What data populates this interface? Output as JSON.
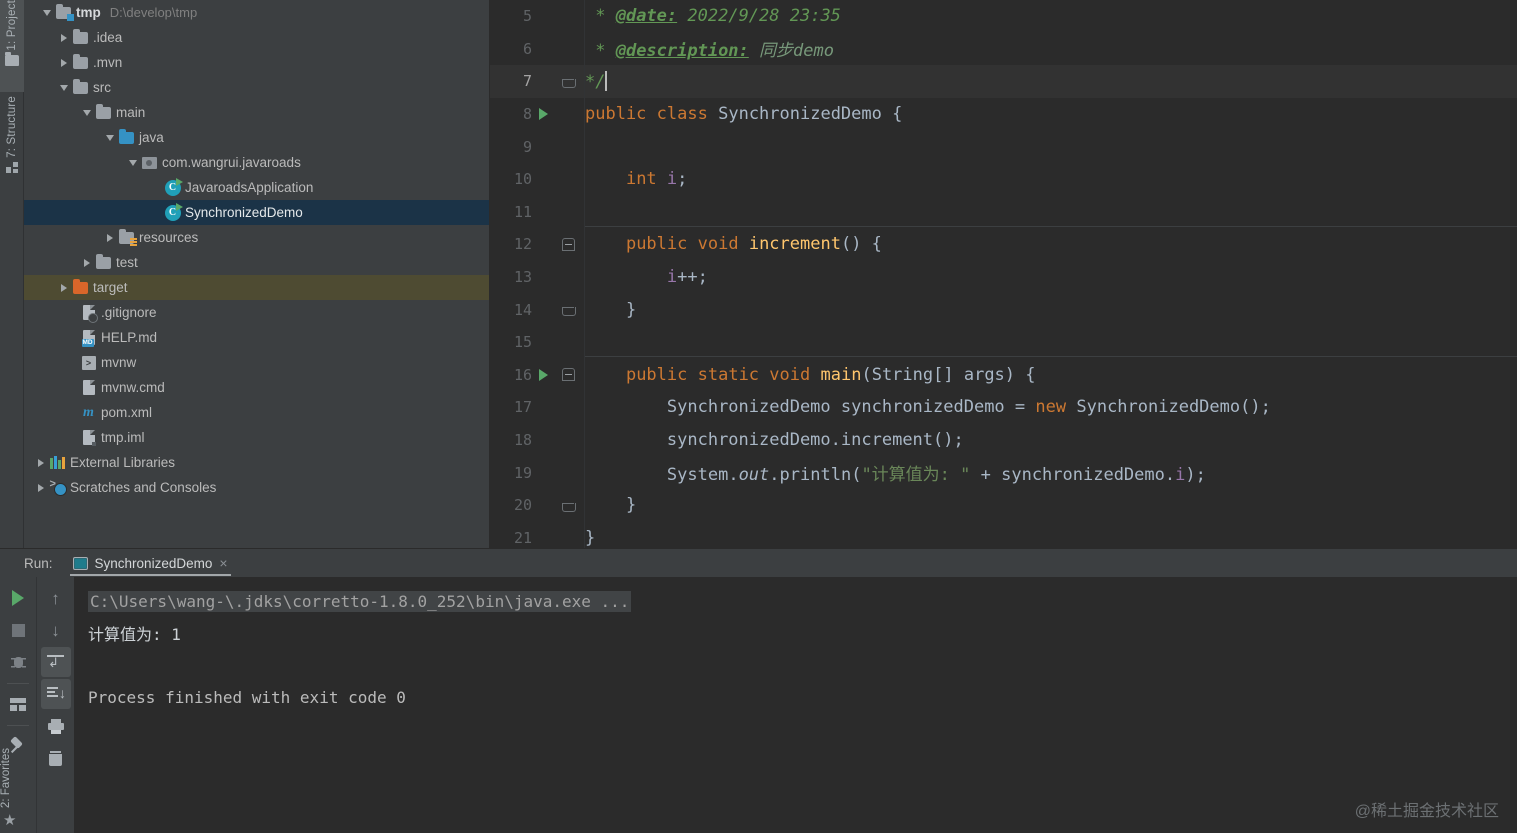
{
  "tool_windows": {
    "project": "1: Project",
    "structure": "7: Structure",
    "favorites": "2: Favorites"
  },
  "project_tree": {
    "root": {
      "name": "tmp",
      "path": "D:\\develop\\tmp"
    },
    "items": [
      {
        "label": ".idea",
        "indent": 1,
        "state": "collapsed",
        "icon": "folder-icon"
      },
      {
        "label": ".mvn",
        "indent": 1,
        "state": "collapsed",
        "icon": "folder-icon"
      },
      {
        "label": "src",
        "indent": 1,
        "state": "expanded",
        "icon": "folder-icon"
      },
      {
        "label": "main",
        "indent": 2,
        "state": "expanded",
        "icon": "folder-icon"
      },
      {
        "label": "java",
        "indent": 3,
        "state": "expanded",
        "icon": "source-folder-icon"
      },
      {
        "label": "com.wangrui.javaroads",
        "indent": 4,
        "state": "expanded",
        "icon": "package-icon"
      },
      {
        "label": "JavaroadsApplication",
        "indent": 5,
        "state": "leaf",
        "icon": "java-class-icon"
      },
      {
        "label": "SynchronizedDemo",
        "indent": 5,
        "state": "leaf",
        "icon": "java-class-icon",
        "selected": true
      },
      {
        "label": "resources",
        "indent": 3,
        "state": "collapsed",
        "icon": "resources-folder-icon"
      },
      {
        "label": "test",
        "indent": 2,
        "state": "collapsed",
        "icon": "folder-icon"
      },
      {
        "label": "target",
        "indent": 1,
        "state": "collapsed",
        "icon": "excluded-folder-icon",
        "highlighted": true
      },
      {
        "label": ".gitignore",
        "indent": 2,
        "state": "leaf",
        "icon": "gitignore-file-icon"
      },
      {
        "label": "HELP.md",
        "indent": 2,
        "state": "leaf",
        "icon": "markdown-file-icon",
        "badge": "MD"
      },
      {
        "label": "mvnw",
        "indent": 2,
        "state": "leaf",
        "icon": "shell-script-icon"
      },
      {
        "label": "mvnw.cmd",
        "indent": 2,
        "state": "leaf",
        "icon": "cmd-file-icon"
      },
      {
        "label": "pom.xml",
        "indent": 2,
        "state": "leaf",
        "icon": "maven-file-icon"
      },
      {
        "label": "tmp.iml",
        "indent": 2,
        "state": "leaf",
        "icon": "module-file-icon"
      },
      {
        "label": "External Libraries",
        "indent": 0,
        "state": "collapsed",
        "icon": "libraries-icon"
      },
      {
        "label": "Scratches and Consoles",
        "indent": 0,
        "state": "collapsed",
        "icon": "scratches-icon"
      }
    ]
  },
  "editor": {
    "first_visible_line": 5,
    "current_line": 7,
    "lines": [
      {
        "n": 5,
        "text": " * @date: 2022/9/28 23:35"
      },
      {
        "n": 6,
        "text": " * @description: 同步demo"
      },
      {
        "n": 7,
        "text": " */"
      },
      {
        "n": 8,
        "text": "public class SynchronizedDemo {"
      },
      {
        "n": 9,
        "text": ""
      },
      {
        "n": 10,
        "text": "    int i;"
      },
      {
        "n": 11,
        "text": ""
      },
      {
        "n": 12,
        "text": "    public void increment() {"
      },
      {
        "n": 13,
        "text": "        i++;"
      },
      {
        "n": 14,
        "text": "    }"
      },
      {
        "n": 15,
        "text": ""
      },
      {
        "n": 16,
        "text": "    public static void main(String[] args) {"
      },
      {
        "n": 17,
        "text": "        SynchronizedDemo synchronizedDemo = new SynchronizedDemo();"
      },
      {
        "n": 18,
        "text": "        synchronizedDemo.increment();"
      },
      {
        "n": 19,
        "text": "        System.out.println(\"计算值为: \" + synchronizedDemo.i);"
      },
      {
        "n": 20,
        "text": "    }"
      },
      {
        "n": 21,
        "text": "}"
      }
    ],
    "tokens": {
      "doc_date_tag": "@date:",
      "doc_date_value": "2022/9/28 23:35",
      "doc_desc_tag": "@description:",
      "doc_desc_value": "同步demo",
      "doc_close": "*/",
      "kw_public": "public",
      "kw_class": "class",
      "kw_void": "void",
      "kw_static": "static",
      "kw_int": "int",
      "kw_new": "new",
      "class_name": "SynchronizedDemo",
      "field_i": "i",
      "method_increment": "increment",
      "method_main": "main",
      "method_println": "println",
      "type_string_array": "String[]",
      "param_args": "args",
      "var_name": "synchronizedDemo",
      "system": "System",
      "out": "out",
      "string_literal": "\"计算值为: \""
    }
  },
  "run_panel": {
    "label": "Run:",
    "tab_name": "SynchronizedDemo",
    "close_label": "×",
    "toolbar_left": [
      {
        "name": "rerun-button",
        "icon": "play-icon"
      },
      {
        "name": "stop-button",
        "icon": "stop-icon"
      },
      {
        "name": "debug-button",
        "icon": "bug-icon"
      },
      {
        "name": "layout-button",
        "icon": "layout-icon"
      },
      {
        "name": "pin-tab-button",
        "icon": "pin-icon"
      }
    ],
    "toolbar_right": [
      {
        "name": "up-button",
        "icon": "arrow-up-icon",
        "label": "↑"
      },
      {
        "name": "down-button",
        "icon": "arrow-down-icon",
        "label": "↓"
      },
      {
        "name": "soft-wrap-button",
        "icon": "soft-wrap-icon",
        "active": true
      },
      {
        "name": "scroll-to-end-button",
        "icon": "scroll-end-icon",
        "active": true
      },
      {
        "name": "print-button",
        "icon": "print-icon"
      },
      {
        "name": "clear-all-button",
        "icon": "trash-icon"
      }
    ],
    "console": {
      "command": "C:\\Users\\wang-\\.jdks\\corretto-1.8.0_252\\bin\\java.exe ...",
      "output": "计算值为: 1",
      "exit_message": "Process finished with exit code 0"
    }
  },
  "watermark": "@稀土掘金技术社区",
  "colors": {
    "panel_bg": "#3c3f41",
    "editor_bg": "#2b2b2b",
    "selection_blue": "#1b3347",
    "excluded_olive": "#4e4b32",
    "keyword_orange": "#cc7832",
    "method_yellow": "#ffc66d",
    "field_purple": "#9876aa",
    "string_green": "#6a8759",
    "javadoc_green": "#629755",
    "run_green": "#59a869",
    "folder_blue": "#3592c4",
    "target_orange": "#d9662a"
  }
}
